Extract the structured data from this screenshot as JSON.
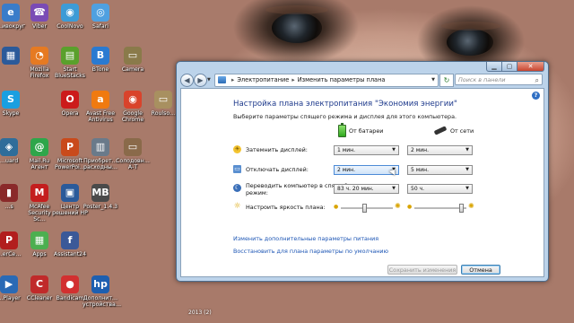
{
  "desktop": {
    "icons": [
      {
        "label": "…ивокруг",
        "glyph": "e",
        "color": "#3a7cc9"
      },
      {
        "label": "Viber",
        "glyph": "☎",
        "color": "#7a4bb5"
      },
      {
        "label": "CoolNovo",
        "glyph": "◉",
        "color": "#3d9bd6"
      },
      {
        "label": "Safari",
        "glyph": "◎",
        "color": "#4fa0e0"
      },
      {
        "label": "",
        "glyph": "▦",
        "color": "#2b5a9a"
      },
      {
        "label": "Mozilla\nFirefox",
        "glyph": "◔",
        "color": "#e67a22"
      },
      {
        "label": "Start\nBlueStacks",
        "glyph": "▤",
        "color": "#5aa02c"
      },
      {
        "label": "BTone",
        "glyph": "B",
        "color": "#2a7ad1"
      },
      {
        "label": "Camera",
        "glyph": "▭",
        "color": "#8a7a4a"
      },
      {
        "label": "",
        "glyph": "S",
        "color": "#1e8fd5"
      },
      {
        "label": "Skype",
        "glyph": "S",
        "color": "#1a9fe0"
      },
      {
        "label": "Opera",
        "glyph": "O",
        "color": "#cc1b1b"
      },
      {
        "label": "Avast Free\nAntivirus",
        "glyph": "a",
        "color": "#f07a10"
      },
      {
        "label": "Google\nChrome",
        "glyph": "◉",
        "color": "#d9432b"
      },
      {
        "label": "Roulso…",
        "glyph": "▭",
        "color": "#a89060"
      },
      {
        "label": "…uard",
        "glyph": "◈",
        "color": "#2f6d9a"
      },
      {
        "label": "Mail.Ru\nАгент",
        "glyph": "@",
        "color": "#2ea64a"
      },
      {
        "label": "Microsoft\nPowerPoi…",
        "glyph": "P",
        "color": "#c94a1b"
      },
      {
        "label": "Приобрет…\nрасходны…",
        "glyph": "▥",
        "color": "#6a7a8a"
      },
      {
        "label": "Солодовн…\nА-Т",
        "glyph": "▭",
        "color": "#8a6a4a"
      },
      {
        "label": "…s",
        "glyph": "▮",
        "color": "#8a2a2a"
      },
      {
        "label": "McAfee\nSecurity Sc…",
        "glyph": "M",
        "color": "#c41e1e"
      },
      {
        "label": "Центр\nрешений HP",
        "glyph": "▣",
        "color": "#2a5a9a"
      },
      {
        "label": "Poster_1.4.3",
        "glyph": "MB",
        "color": "#4a4a4a"
      },
      {
        "label": "…erCe…",
        "glyph": "P",
        "color": "#b21e1e"
      },
      {
        "label": "Apps",
        "glyph": "▦",
        "color": "#4caf50"
      },
      {
        "label": "Assistant24",
        "glyph": "f",
        "color": "#3b5998"
      },
      {
        "label": "…Player",
        "glyph": "▶",
        "color": "#2a6ab5"
      },
      {
        "label": "CCleaner",
        "glyph": "C",
        "color": "#c02a2a"
      },
      {
        "label": "Bandicam",
        "glyph": "●",
        "color": "#d23030"
      },
      {
        "label": "Дополнит…\nустройства…",
        "glyph": "hp",
        "color": "#1d5fb0"
      }
    ],
    "clock_fragment": "2013 (2)"
  },
  "window": {
    "breadcrumb": [
      "Электропитание",
      "Изменить параметры плана"
    ],
    "search_placeholder": "Поиск в панели управления",
    "plan_title": "Настройка плана электропитания \"Экономия энергии\"",
    "plan_description": "Выберите параметры спящего режима и дисплея для этого компьютера.",
    "columns": {
      "battery": "От батареи",
      "plugged": "От сети"
    },
    "rows": [
      {
        "label": "Затемнить дисплей:",
        "battery": "1 мин.",
        "plugged": "2 мин."
      },
      {
        "label": "Отключать дисплей:",
        "battery": "2 мин.",
        "plugged": "5 мин."
      },
      {
        "label": "Переводить компьютер в спящий\nрежим:",
        "battery": "83 ч. 20 мин.",
        "plugged": "50 ч."
      }
    ],
    "brightness": {
      "label": "Настроить яркость плана:",
      "battery_level": 0.45,
      "plugged_level": 0.95
    },
    "links": {
      "advanced": "Изменить дополнительные параметры питания",
      "restore": "Восстановить для плана параметры по умолчанию"
    },
    "buttons": {
      "save": "Сохранить изменения",
      "cancel": "Отмена"
    }
  }
}
